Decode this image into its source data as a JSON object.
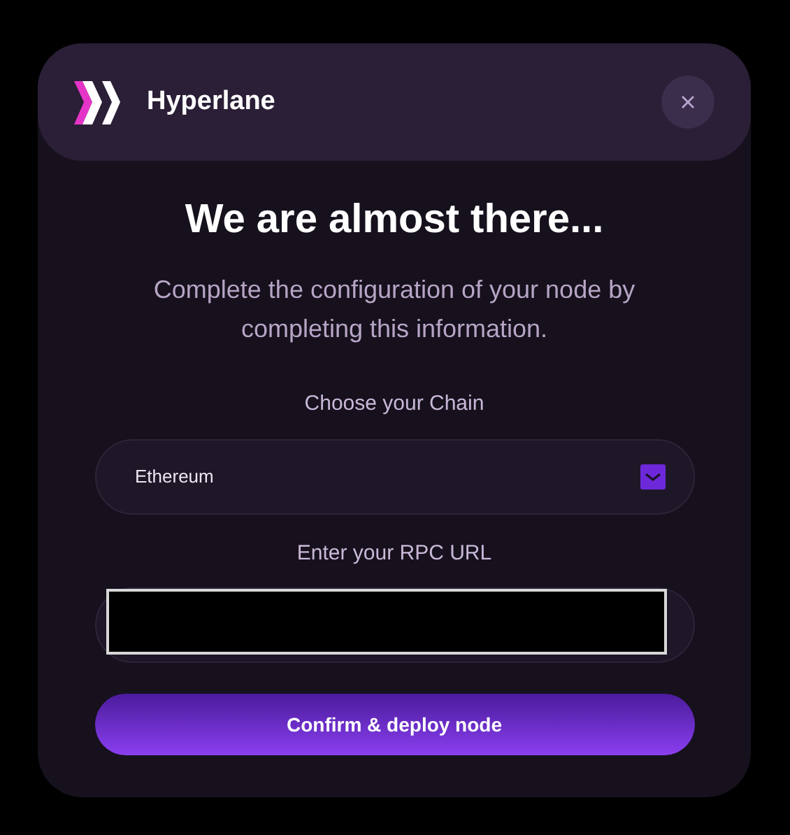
{
  "modal": {
    "brand": "Hyperlane",
    "title": "We are almost there...",
    "subtitle": "Complete the configuration of your node by completing this information.",
    "chain_label": "Choose your Chain",
    "chain_select": {
      "value": "Ethereum"
    },
    "rpc_label": "Enter your RPC URL",
    "rpc_field": {
      "redacted": true
    },
    "confirm_button": "Confirm & deploy node"
  }
}
